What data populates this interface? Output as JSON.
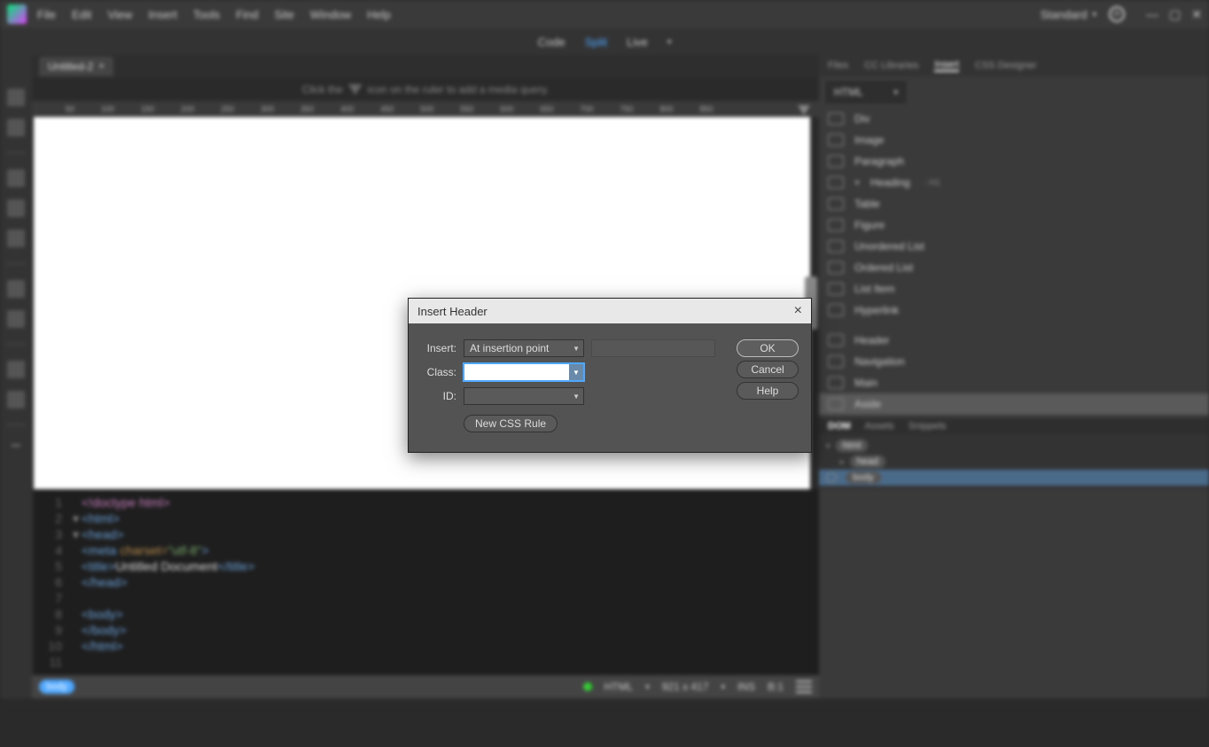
{
  "menu": {
    "items": [
      "File",
      "Edit",
      "View",
      "Insert",
      "Tools",
      "Find",
      "Site",
      "Window",
      "Help"
    ]
  },
  "workspace": {
    "label": "Standard",
    "sync": "⟳"
  },
  "view_switch": {
    "code": "Code",
    "split": "Split",
    "live": "Live"
  },
  "tab": {
    "name": "Untitled-2",
    "close": "×"
  },
  "hint": {
    "pre": "Click the",
    "post": "icon on the ruler to add a media query."
  },
  "ruler_ticks": [
    "50",
    "100",
    "150",
    "200",
    "250",
    "300",
    "350",
    "400",
    "450",
    "500",
    "550",
    "600",
    "650",
    "700",
    "750",
    "800",
    "850"
  ],
  "code": {
    "l1": "<!doctype html>",
    "l2o": "<html>",
    "l2c": "",
    "l3o": "<head>",
    "l4": "<meta charset=\"utf-8\">",
    "l5a": "<title>",
    "l5b": "Untitled Document",
    "l5c": "</title>",
    "l6": "</head>",
    "l8": "<body>",
    "l9": "</body>",
    "l10": "</html>"
  },
  "status": {
    "tag": "body",
    "lang": "HTML",
    "dims": "921 x 417",
    "ins": "INS",
    "enc": "B:1"
  },
  "right_tabs": {
    "files": "Files",
    "cclib": "CC Libraries",
    "insert": "Insert",
    "cssd": "CSS Designer"
  },
  "insert_dd": "HTML",
  "insert_items": [
    {
      "label": "Div"
    },
    {
      "label": "Image"
    },
    {
      "label": "Paragraph"
    },
    {
      "label": "Heading",
      "sub": ": H1"
    },
    {
      "label": "Table"
    },
    {
      "label": "Figure"
    },
    {
      "label": "Unordered List"
    },
    {
      "label": "Ordered List"
    },
    {
      "label": "List Item"
    },
    {
      "label": "Hyperlink"
    },
    {
      "label": "Header"
    },
    {
      "label": "Navigation"
    },
    {
      "label": "Main"
    },
    {
      "label": "Aside",
      "selected": true
    }
  ],
  "dom": {
    "tabs": {
      "dom": "DOM",
      "assets": "Assets",
      "snippets": "Snippets"
    },
    "nodes": {
      "html": "html",
      "head": "head",
      "body": "body"
    }
  },
  "dialog": {
    "title": "Insert Header",
    "close": "×",
    "labels": {
      "insert": "Insert:",
      "class": "Class:",
      "id": "ID:"
    },
    "insert_value": "At insertion point",
    "class_value": "",
    "id_value": "",
    "newcss": "New CSS Rule",
    "ok": "OK",
    "cancel": "Cancel",
    "help": "Help"
  }
}
